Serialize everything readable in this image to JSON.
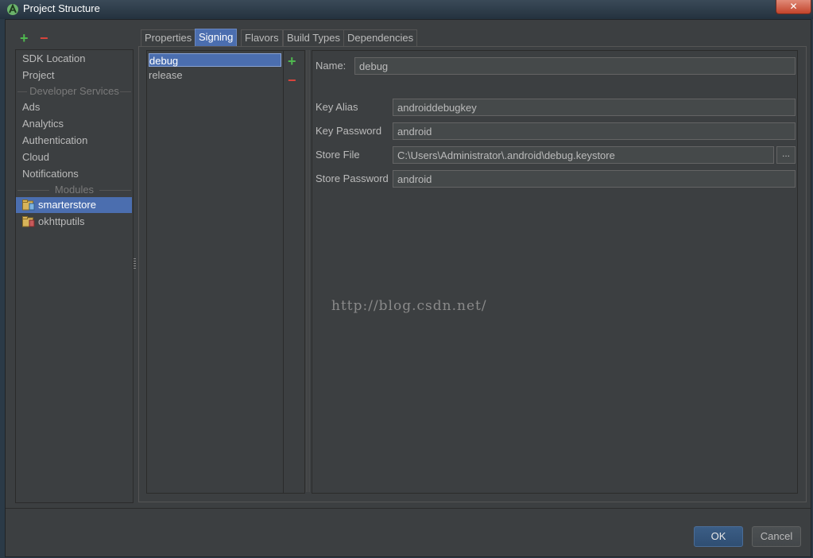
{
  "window": {
    "title": "Project Structure",
    "close_label": "✕"
  },
  "toolbar": {
    "add": "+",
    "remove": "−"
  },
  "nav": {
    "items_top": [
      "SDK Location",
      "Project"
    ],
    "sep_dev": "Developer Services",
    "dev_items": [
      "Ads",
      "Analytics",
      "Authentication",
      "Cloud",
      "Notifications"
    ],
    "sep_modules": "Modules",
    "modules": [
      {
        "label": "smarterstore",
        "selected": true
      },
      {
        "label": "okhttputils",
        "selected": false
      }
    ]
  },
  "tabs": [
    "Properties",
    "Signing",
    "Flavors",
    "Build Types",
    "Dependencies"
  ],
  "active_tab": "Signing",
  "signing": {
    "configs": [
      "debug",
      "release"
    ],
    "selected": "debug",
    "add": "+",
    "remove": "−"
  },
  "form": {
    "name_label": "Name:",
    "name_value": "debug",
    "key_alias_label": "Key Alias",
    "key_alias_value": "androiddebugkey",
    "key_password_label": "Key Password",
    "key_password_value": "android",
    "store_file_label": "Store File",
    "store_file_value": "C:\\Users\\Administrator\\.android\\debug.keystore",
    "browse_label": "...",
    "store_password_label": "Store Password",
    "store_password_value": "android"
  },
  "watermark": "http://blog.csdn.net/",
  "buttons": {
    "ok": "OK",
    "cancel": "Cancel"
  },
  "colors": {
    "accent": "#4b6eaf",
    "add": "#4fb84f",
    "remove": "#d9443c"
  }
}
